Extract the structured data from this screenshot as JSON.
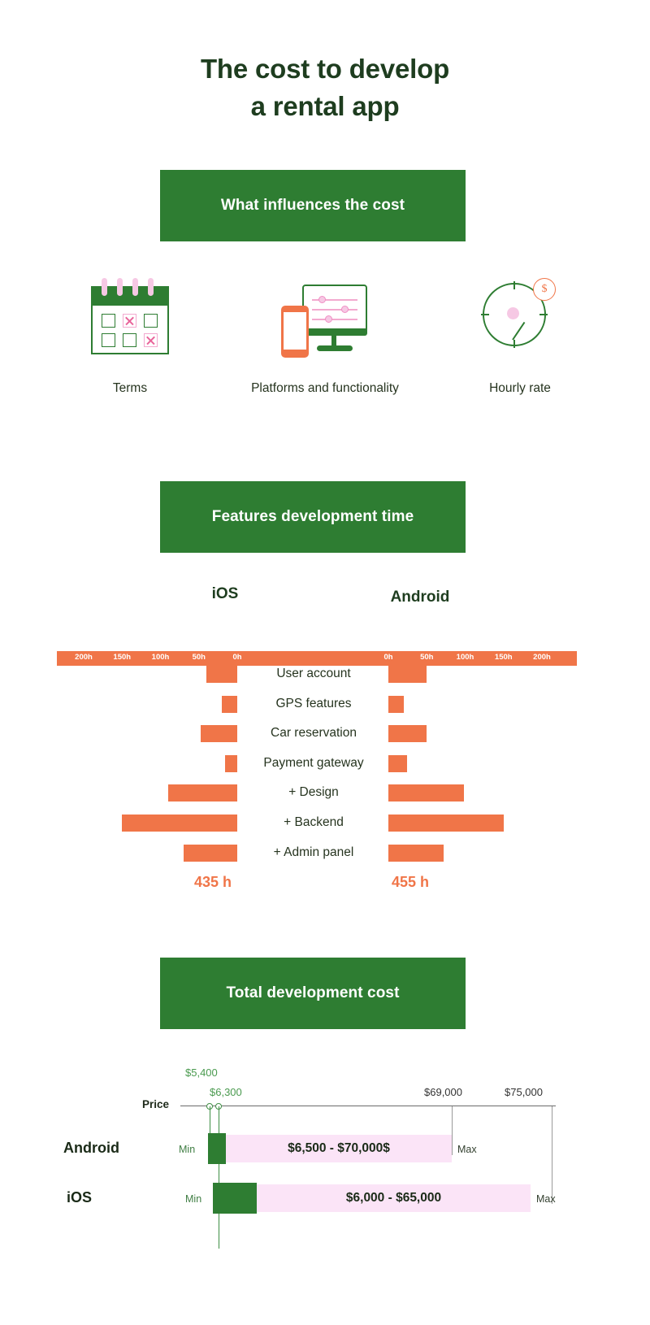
{
  "title": {
    "line1": "The cost to develop",
    "line2": "a rental app"
  },
  "sections": {
    "influences": "What influences the cost",
    "features": "Features development time",
    "total_cost": "Total development cost"
  },
  "influences": {
    "items": [
      {
        "icon": "calendar-icon",
        "label": "Terms"
      },
      {
        "icon": "monitor-phone-icon",
        "label": "Platforms and functionality"
      },
      {
        "icon": "clock-dollar-icon",
        "label": "Hourly rate"
      }
    ]
  },
  "platforms": {
    "ios": "iOS",
    "android": "Android"
  },
  "chart_data": {
    "type": "bar",
    "title": "Features development time",
    "orientation": "horizontal-diverging",
    "unit": "h",
    "axis_ticks_left": [
      "200h",
      "150h",
      "100h",
      "50h",
      "0h"
    ],
    "axis_ticks_right": [
      "0h",
      "50h",
      "100h",
      "150h",
      "200h"
    ],
    "axis_max": 200,
    "categories": [
      "User account",
      "GPS features",
      "Car reservation",
      "Payment gateway",
      "+ Design",
      "+ Backend",
      "+ Admin panel"
    ],
    "series": [
      {
        "name": "iOS",
        "values": [
          40,
          20,
          48,
          16,
          90,
          150,
          70
        ]
      },
      {
        "name": "Android",
        "values": [
          50,
          20,
          50,
          24,
          98,
          150,
          72
        ]
      }
    ],
    "totals": {
      "ios": "435 h",
      "android": "455 h"
    },
    "xlabel": "",
    "ylabel": "",
    "grid": false,
    "legend": "top"
  },
  "price_chart": {
    "type": "bar",
    "axis_label": "Price",
    "annotations": [
      {
        "label": "$5,400",
        "color": "green",
        "value": 5400
      },
      {
        "label": "$6,300",
        "color": "green",
        "value": 6300
      },
      {
        "label": "$69,000",
        "color": "dark",
        "value": 69000
      },
      {
        "label": "$75,000",
        "color": "dark",
        "value": 75000
      }
    ],
    "rows": [
      {
        "platform": "Android",
        "min_label": "Min",
        "max_label": "Max",
        "range_text": "$6,500 - $70,000$",
        "min": 6500,
        "max": 70000
      },
      {
        "platform": "iOS",
        "min_label": "Min",
        "max_label": "Max",
        "range_text": "$6,000 - $65,000",
        "min": 6000,
        "max": 65000
      }
    ]
  },
  "colors": {
    "green": "#2e7d32",
    "dark_green": "#1e3d1f",
    "orange": "#f07548",
    "pink": "#fbe4f7",
    "accent_pink": "#f3a9cf"
  }
}
